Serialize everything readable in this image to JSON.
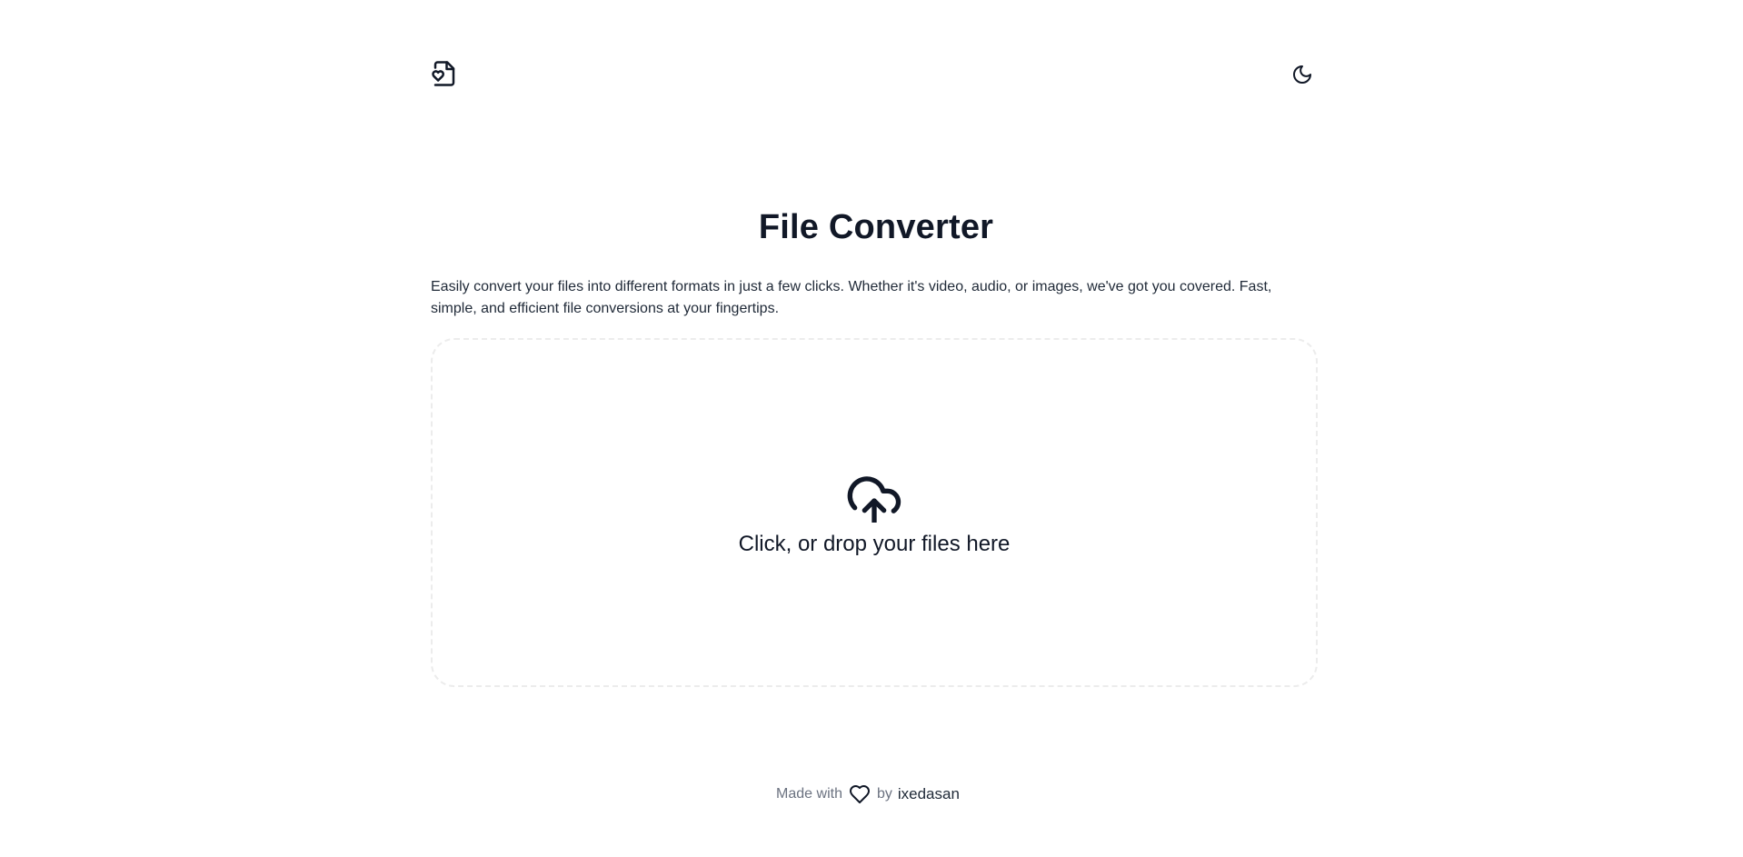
{
  "header": {
    "logo_icon": "file-heart-icon",
    "theme_toggle_icon": "moon-icon"
  },
  "main": {
    "title": "File Converter",
    "description": "Easily convert your files into different formats in just a few clicks. Whether it's video, audio, or images, we've got you covered. Fast, simple, and efficient file conversions at your fingertips.",
    "dropzone": {
      "icon": "cloud-upload-icon",
      "text": "Click, or drop your files here"
    }
  },
  "footer": {
    "made_with": "Made with",
    "heart_icon": "heart-icon",
    "by": "by",
    "author": "ixedasan"
  }
}
